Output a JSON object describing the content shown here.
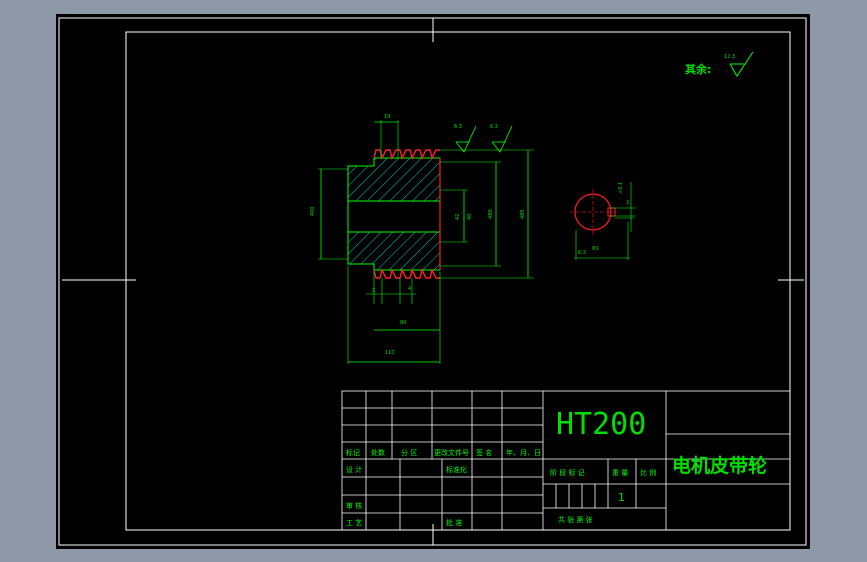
{
  "colors": {
    "background": "#000000",
    "frame": "#ffffff",
    "dimension": "#00ff00",
    "section_edge": "#ff2020",
    "hatch": "#00c8d0",
    "title_text": "#00ff00"
  },
  "roughness": {
    "general_label": "其余:",
    "general_value": "12.3",
    "top_left_value": "6.3",
    "top_right_value": "6.3"
  },
  "front_view_dims": {
    "groove_pitch": "19",
    "hub_diameter": "40",
    "bore_diameter": "42",
    "outer_diameter": "480",
    "overall_diameter": "485",
    "left_dim": "400",
    "bottom_small_a": "2",
    "bottom_small_b": "4",
    "groove_width": "80",
    "total_width": "110"
  },
  "side_view_dims": {
    "keyway_tol": "+0.1",
    "keyway_depth": "2",
    "bore_label": "Φ1",
    "bottom_label": "6.3"
  },
  "title_block": {
    "material": "HT200",
    "part_name": "电机皮带轮",
    "header_labels": [
      "标记",
      "处数",
      "分 区",
      "更改文件号",
      "签 名",
      "年、月、日"
    ],
    "design_label": "设 计",
    "standardization_label": "标准化",
    "review_label": "审 核",
    "process_label": "工 艺",
    "approve_label": "批 准",
    "stage_mark_label": "阶 段 标 记",
    "weight_label": "重 量",
    "scale_label": "比 例",
    "scale_value": "1",
    "sheets_label": "共   张   第   张"
  }
}
